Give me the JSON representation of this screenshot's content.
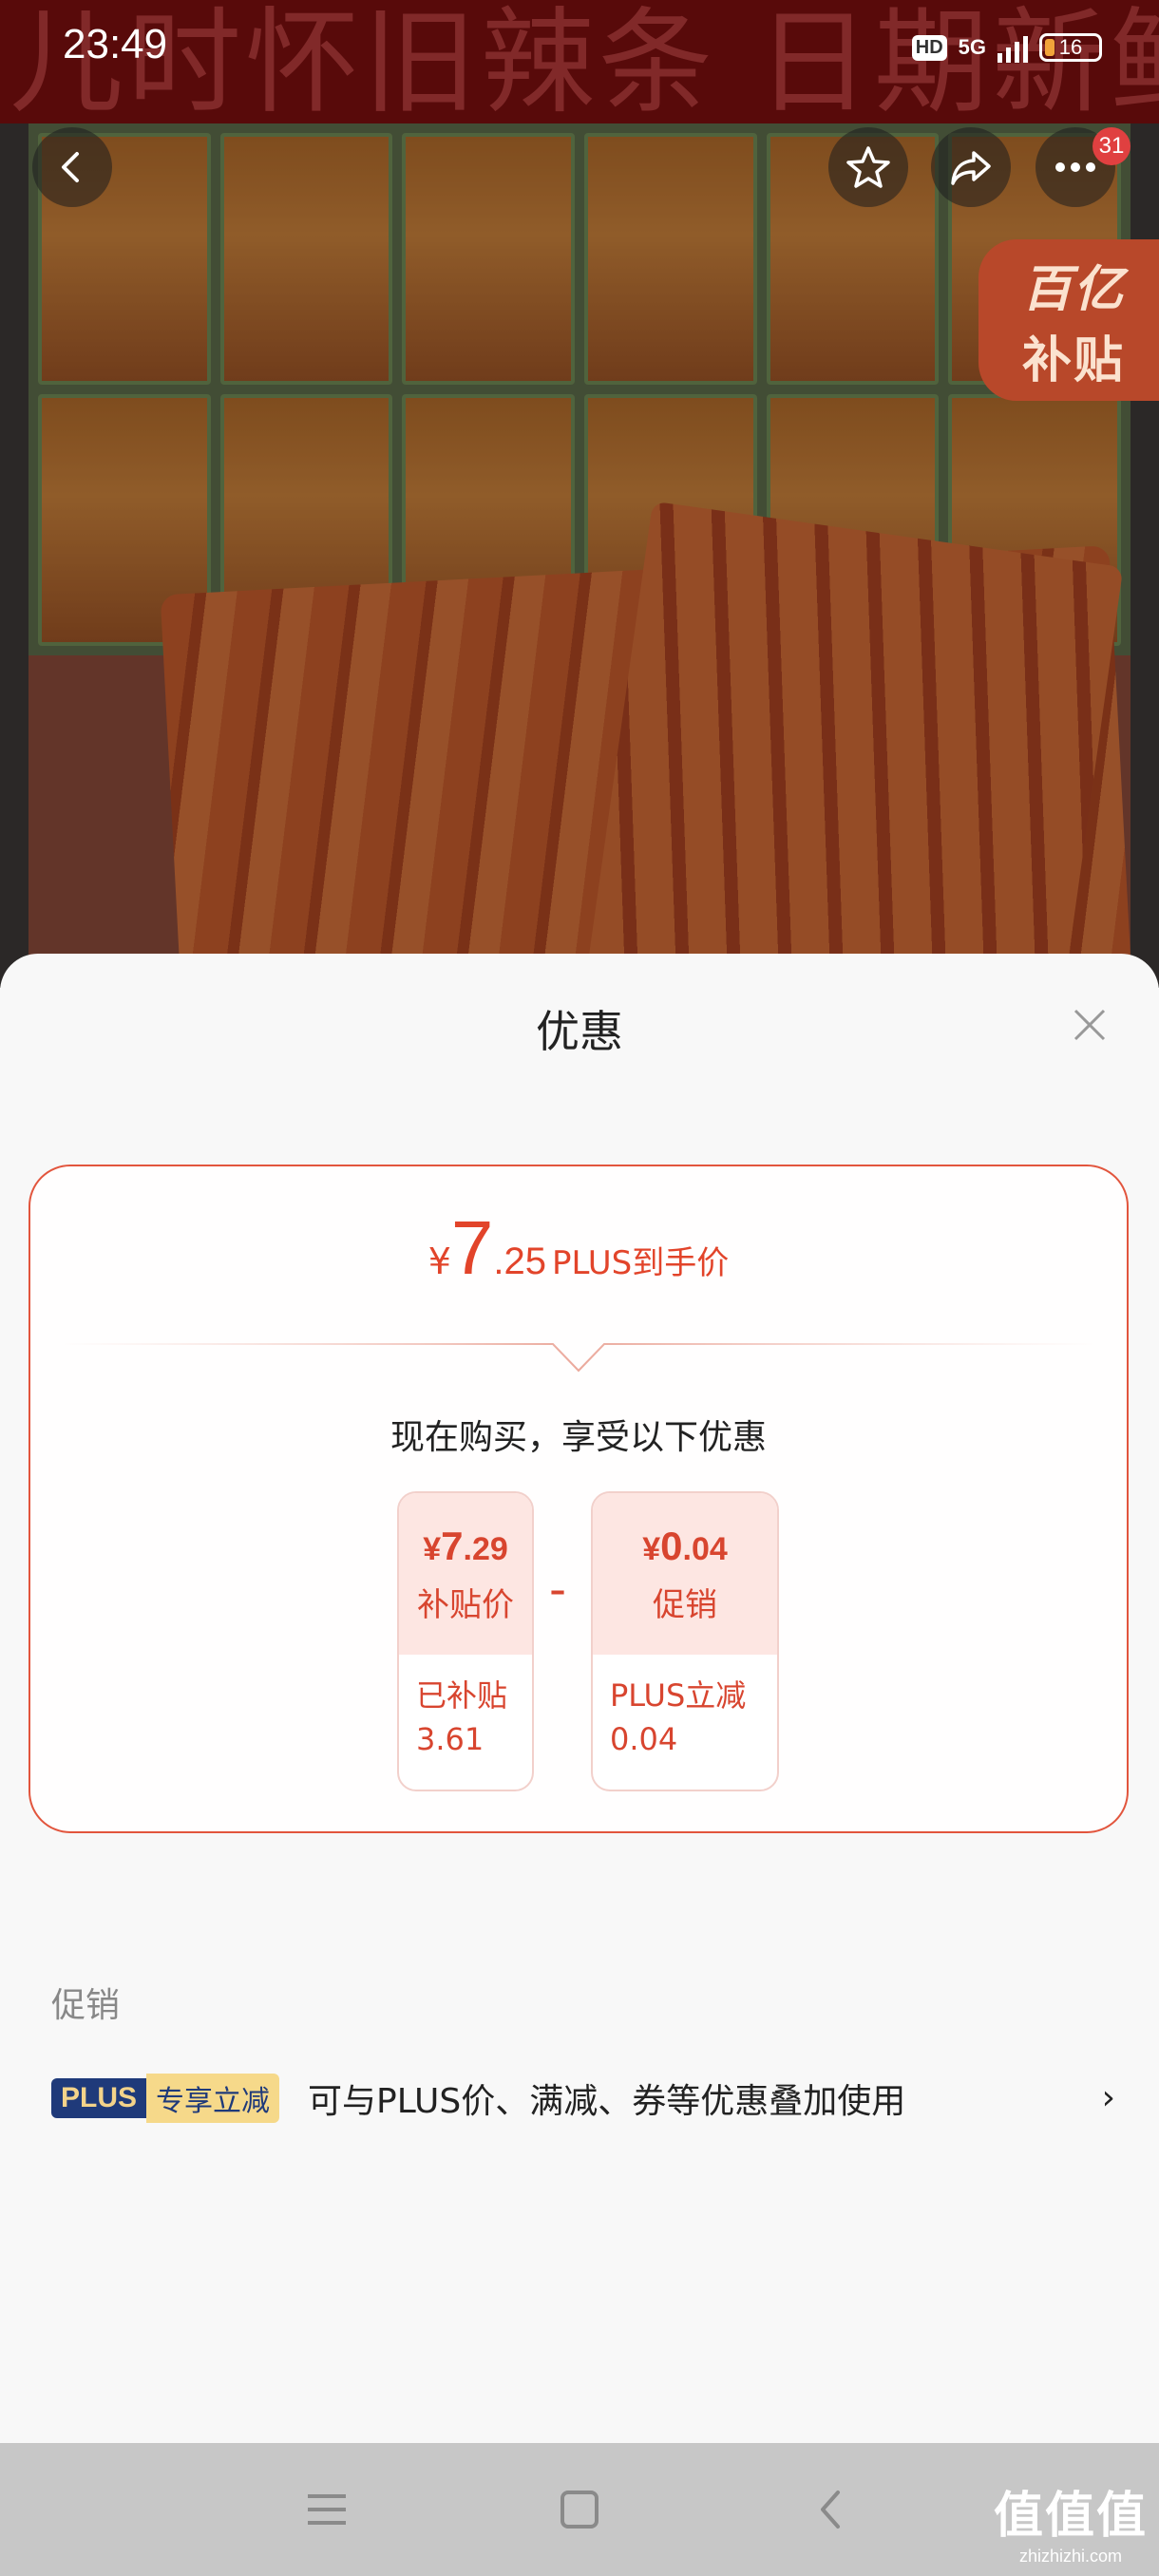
{
  "status_bar": {
    "time": "23:49",
    "hd": "HD",
    "network": "5G",
    "battery": "16"
  },
  "product_image": {
    "banner_text": "儿时怀旧辣条 日期新鲜",
    "subsidy_badge_line1": "百亿",
    "subsidy_badge_line2": "补贴",
    "message_count": "31"
  },
  "sheet": {
    "title": "优惠",
    "final_price": {
      "currency": "¥",
      "integer": "7",
      "decimal": ".25",
      "label": "PLUS到手价"
    },
    "subtitle": "现在购买，享受以下优惠",
    "breakdown": [
      {
        "currency": "¥",
        "integer": "7",
        "decimal": ".29",
        "label": "补贴价",
        "detail_line1": "已补贴",
        "detail_line2": "3.61"
      },
      {
        "currency": "¥",
        "integer": "0",
        "decimal": ".04",
        "label": "促销",
        "detail_line1": "PLUS立减",
        "detail_line2": "0.04"
      }
    ],
    "operator": "-",
    "promo_section": {
      "heading": "促销",
      "tag_plus": "PLUS",
      "tag_exclusive": "专享立减",
      "description": "可与PLUS价、满减、券等优惠叠加使用",
      "chevron": "›"
    }
  },
  "watermark": {
    "line1": "值值值",
    "line2": "zhizhizhi.com"
  },
  "colors": {
    "accent": "#e2442a",
    "plus_tag_bg": "#1f3a7a",
    "plus_tag_gold": "#f6d98a"
  }
}
